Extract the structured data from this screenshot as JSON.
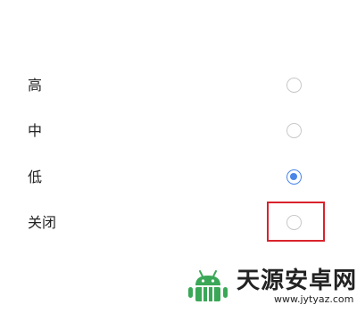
{
  "options": [
    {
      "label": "高",
      "selected": false
    },
    {
      "label": "中",
      "selected": false
    },
    {
      "label": "低",
      "selected": true
    },
    {
      "label": "关闭",
      "selected": false
    }
  ],
  "highlighted_option": "关闭",
  "colors": {
    "accent": "#4a86e8",
    "highlight_box": "#d9232d",
    "watermark_green": "#3aa757"
  },
  "watermark": {
    "title": "天源安卓网",
    "url": "www.jytyaz.com",
    "icon": "android-robot-icon"
  }
}
